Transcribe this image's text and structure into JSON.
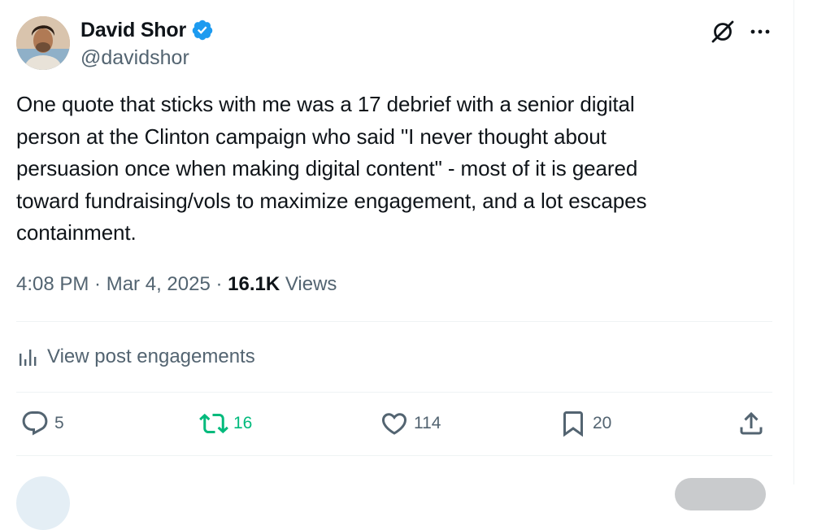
{
  "author": {
    "name": "David Shor",
    "handle": "@davidshor",
    "verified": true,
    "avatar_icon": "profile-photo"
  },
  "tweet": {
    "text": "One quote that sticks with me was a 17 debrief with a senior digital\nperson at the Clinton campaign who said \"I never thought about\npersuasion once when making digital content\" - most of it is geared\ntoward fundraising/vols to maximize engagement, and a lot escapes\ncontainment.",
    "time": "4:08 PM",
    "date": "Mar 4, 2025",
    "views_count": "16.1K",
    "views_label": "Views",
    "separator": " · "
  },
  "engagements": {
    "label": "View post engagements",
    "icon": "bar-chart-icon"
  },
  "actions": {
    "replies": "5",
    "retweets": "16",
    "likes": "114",
    "bookmarks": "20"
  },
  "colors": {
    "text": "#0f1419",
    "muted": "#536471",
    "verified": "#1d9bf0",
    "retweet": "#00ba7c",
    "divider": "#eff3f4"
  }
}
